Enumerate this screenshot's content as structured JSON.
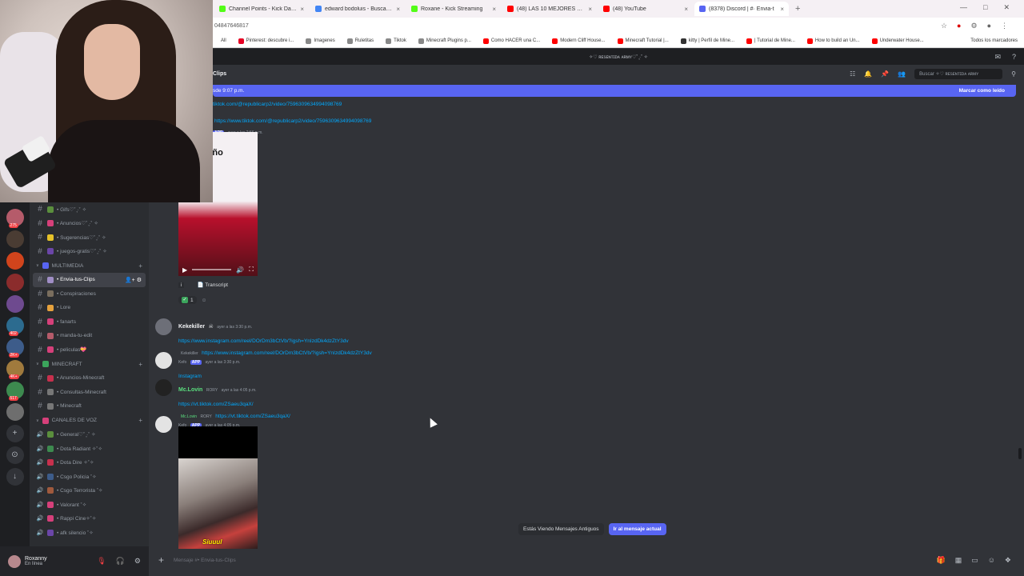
{
  "browser": {
    "tabs": [
      {
        "label": "Channel Points - Kick Dashboa",
        "color": "#53fc18",
        "active": false
      },
      {
        "label": "edward bodoluis - Buscar con G",
        "color": "#4285f4",
        "active": false
      },
      {
        "label": "Roxane - Kick Streaming",
        "color": "#53fc18",
        "active": false
      },
      {
        "label": "(48) LAS 10 MEJORES CANCIO",
        "color": "#ff0000",
        "active": false
      },
      {
        "label": "(48) YouTube",
        "color": "#ff0000",
        "active": false
      },
      {
        "label": "(8378) Discord | #· Envia-t",
        "color": "#5865f2",
        "active": true
      }
    ],
    "url": "04847646817",
    "bookmarks": [
      {
        "label": "All",
        "color": "#ffffff"
      },
      {
        "label": "Pinterest: descubre i...",
        "color": "#e60023"
      },
      {
        "label": "Imagenes",
        "color": "#888888"
      },
      {
        "label": "Ruletitas",
        "color": "#888888"
      },
      {
        "label": "Tiktok",
        "color": "#888888"
      },
      {
        "label": "Minecraft Plugins p...",
        "color": "#888888"
      },
      {
        "label": "Como HACER una C...",
        "color": "#ff0000"
      },
      {
        "label": "Modern Cliff House...",
        "color": "#ff0000"
      },
      {
        "label": "Minecraft Tutorial |...",
        "color": "#ff0000"
      },
      {
        "label": "kitty | Perfil de Mine...",
        "color": "#333333"
      },
      {
        "label": "| Tutorial de Mine...",
        "color": "#ff0000"
      },
      {
        "label": "How to build an Un...",
        "color": "#ff0000"
      },
      {
        "label": "Underwater House...",
        "color": "#ff0000"
      }
    ],
    "all_bookmarks": "Todos los marcadores"
  },
  "discord": {
    "server_title": "✧♡ ʀᴇsᴇɴᴛɪᴅᴀ ᴀʀᴍʏ♡˚ ̥·˚ ✧",
    "channel_header": "Clips",
    "search_placeholder": "Buscar ✧♡ ʀᴇsᴇɴᴛɪᴅᴀ ᴀʀᴍʏ",
    "new_messages_bar": "sde 9:07 p.m.",
    "mark_read": "Marcar como leído",
    "servers": [
      {
        "color": "#b55b6a",
        "badge": "275"
      },
      {
        "color": "#4a3c33",
        "badge": ""
      },
      {
        "color": "#d1441c",
        "badge": ""
      },
      {
        "color": "#8b2c2c",
        "badge": ""
      },
      {
        "color": "#6e4a8f",
        "badge": ""
      },
      {
        "color": "#2c6b8f",
        "badge": "402"
      },
      {
        "color": "#3d5c8a",
        "badge": "2K+"
      },
      {
        "color": "#a07a3d",
        "badge": "4K+"
      },
      {
        "color": "#3d8a4f",
        "badge": "517"
      },
      {
        "color": "#6e6e6e",
        "badge": ""
      }
    ],
    "channels_top": [
      {
        "label": "• Gifs♡˚ ̥·˚ ✧",
        "emoji": "#5b8f3d"
      },
      {
        "label": "• Anuncios♡˚ ̥·˚ ✧",
        "emoji": "#d6407a"
      },
      {
        "label": "• Sugerencias♡˚ ̥·˚ ✧",
        "emoji": "#e6c229"
      },
      {
        "label": "• juegos-gratis♡˚ ̥·˚ ✧",
        "emoji": "#6b46a8"
      }
    ],
    "cat_multimedia": "Multimedia",
    "channels_multimedia": [
      {
        "label": "• Envia-tus-Clips",
        "emoji": "#a08ec6",
        "selected": true
      },
      {
        "label": "• Conspiraciones",
        "emoji": "#7a6e5e",
        "selected": false
      },
      {
        "label": "• Lore",
        "emoji": "#e6a23d",
        "selected": false
      },
      {
        "label": "• fanarts",
        "emoji": "#d6407a",
        "selected": false
      },
      {
        "label": "• manda-tu-edit",
        "emoji": "#b55b6a",
        "selected": false
      },
      {
        "label": "• peliculas💝",
        "emoji": "#d6407a",
        "selected": false
      }
    ],
    "cat_minecraft": "Minecraft",
    "channels_minecraft": [
      {
        "label": "• Anuncios-Minecraft",
        "emoji": "#c7304d"
      },
      {
        "label": "• Consultas-Minecraft",
        "emoji": "#777777"
      },
      {
        "label": "• Minecraft",
        "emoji": "#777777"
      }
    ],
    "cat_voice": "Canales de voz",
    "channels_voice": [
      {
        "label": "• General♡˚ ̥·˚ ✧",
        "emoji": "#5b8f3d"
      },
      {
        "label": "• Dota Radiant ✧˚✧",
        "emoji": "#3d8a4f"
      },
      {
        "label": "• Dota Dire ✧˚✧",
        "emoji": "#c7304d"
      },
      {
        "label": "• Csgo Policia ˚✧",
        "emoji": "#3d5c8a"
      },
      {
        "label": "• Csgo Terrorista ˚✧",
        "emoji": "#a05a3d"
      },
      {
        "label": "• Valorant ˚✧",
        "emoji": "#d6407a"
      },
      {
        "label": "• Rappi Cine✧˚✧",
        "emoji": "#d6407a"
      },
      {
        "label": "• afk silencio ˚✧",
        "emoji": "#6b46a8"
      }
    ],
    "user": {
      "name": "Roxanny",
      "status": "En línea"
    },
    "messages": {
      "link0": "tiktok.com/@republicarp2/video/7596309634994098769",
      "link1": "https://www.tiktok.com/@republicarp2/video/7596309634994098769",
      "meta1": "ayer a las 2:56 p.m.",
      "video1_text": "ita del Año\nando de\njo malo",
      "transcript": "Transcript",
      "react_count": "1",
      "kk_name": "Kekekiller",
      "kk_meta": "ayer a las 3:30 p.m.",
      "kk_link": "https://www.instagram.com/reel/DOrDm3bCtVb/?igsh=YnIzdDk4dzZtY3dv",
      "reply1_name": "Kekekiller",
      "reply1_link": "https://www.instagram.com/reel/DOrDm3bCtVb/?igsh=YnIzdDk4dzZtY3dv",
      "bot_name": "Kefo",
      "app_tag": "APP",
      "bot_meta1": "ayer a las 3:30 p.m.",
      "bot_text1": "Instagram",
      "mc_name": "Mc.Lovin",
      "mc_tag": "RORY",
      "mc_meta": "ayer a las 4:05 p.m.",
      "mc_link": "https://vt.tiktok.com/ZSaeu3qaX/",
      "reply2_name": "Mc.Lovin",
      "reply2_tag": "RORY",
      "reply2_link": "https://vt.tiktok.com/ZSaeu3qaX/",
      "bot_meta2": "ayer a las 4:05 p.m.",
      "video2_sticker": "Siuuul"
    },
    "jump_text": "Estás Viendo Mensajes Antiguos",
    "jump_button": "Ir al mensaje actual",
    "composer_placeholder": "Mensaje #• Envia-tus-Clips"
  }
}
